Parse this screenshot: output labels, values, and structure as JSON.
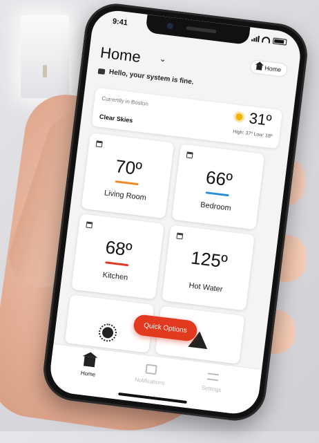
{
  "status": {
    "time": "9:41"
  },
  "header": {
    "title": "Home",
    "home_button": "Home",
    "subtitle": "Hello, your system is fine."
  },
  "weather": {
    "location": "Currently in Boston",
    "condition": "Clear Skies",
    "temp": "31º",
    "high_low": "High: 37º Low: 18º"
  },
  "cards": [
    {
      "value": "70º",
      "name": "Living Room",
      "bar_color": "#f08a24"
    },
    {
      "value": "66º",
      "name": "Bedroom",
      "bar_color": "#2a8fd8"
    },
    {
      "value": "68º",
      "name": "Kitchen",
      "bar_color": "#e23a1f"
    },
    {
      "value": "125º",
      "name": "Hot Water",
      "bar_color": ""
    }
  ],
  "quick_options": "Quick Options",
  "tabs": {
    "home": "Home",
    "notifications": "Notifications",
    "settings": "Settings"
  },
  "colors": {
    "accent": "#e23a1f"
  }
}
